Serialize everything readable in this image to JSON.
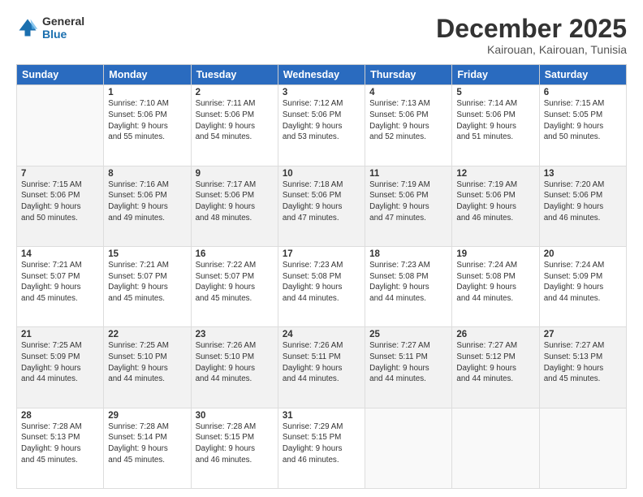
{
  "logo": {
    "line1": "General",
    "line2": "Blue"
  },
  "title": "December 2025",
  "location": "Kairouan, Kairouan, Tunisia",
  "header_days": [
    "Sunday",
    "Monday",
    "Tuesday",
    "Wednesday",
    "Thursday",
    "Friday",
    "Saturday"
  ],
  "weeks": [
    [
      {
        "day": "",
        "info": ""
      },
      {
        "day": "1",
        "info": "Sunrise: 7:10 AM\nSunset: 5:06 PM\nDaylight: 9 hours\nand 55 minutes."
      },
      {
        "day": "2",
        "info": "Sunrise: 7:11 AM\nSunset: 5:06 PM\nDaylight: 9 hours\nand 54 minutes."
      },
      {
        "day": "3",
        "info": "Sunrise: 7:12 AM\nSunset: 5:06 PM\nDaylight: 9 hours\nand 53 minutes."
      },
      {
        "day": "4",
        "info": "Sunrise: 7:13 AM\nSunset: 5:06 PM\nDaylight: 9 hours\nand 52 minutes."
      },
      {
        "day": "5",
        "info": "Sunrise: 7:14 AM\nSunset: 5:06 PM\nDaylight: 9 hours\nand 51 minutes."
      },
      {
        "day": "6",
        "info": "Sunrise: 7:15 AM\nSunset: 5:05 PM\nDaylight: 9 hours\nand 50 minutes."
      }
    ],
    [
      {
        "day": "7",
        "info": "Sunrise: 7:15 AM\nSunset: 5:06 PM\nDaylight: 9 hours\nand 50 minutes."
      },
      {
        "day": "8",
        "info": "Sunrise: 7:16 AM\nSunset: 5:06 PM\nDaylight: 9 hours\nand 49 minutes."
      },
      {
        "day": "9",
        "info": "Sunrise: 7:17 AM\nSunset: 5:06 PM\nDaylight: 9 hours\nand 48 minutes."
      },
      {
        "day": "10",
        "info": "Sunrise: 7:18 AM\nSunset: 5:06 PM\nDaylight: 9 hours\nand 47 minutes."
      },
      {
        "day": "11",
        "info": "Sunrise: 7:19 AM\nSunset: 5:06 PM\nDaylight: 9 hours\nand 47 minutes."
      },
      {
        "day": "12",
        "info": "Sunrise: 7:19 AM\nSunset: 5:06 PM\nDaylight: 9 hours\nand 46 minutes."
      },
      {
        "day": "13",
        "info": "Sunrise: 7:20 AM\nSunset: 5:06 PM\nDaylight: 9 hours\nand 46 minutes."
      }
    ],
    [
      {
        "day": "14",
        "info": "Sunrise: 7:21 AM\nSunset: 5:07 PM\nDaylight: 9 hours\nand 45 minutes."
      },
      {
        "day": "15",
        "info": "Sunrise: 7:21 AM\nSunset: 5:07 PM\nDaylight: 9 hours\nand 45 minutes."
      },
      {
        "day": "16",
        "info": "Sunrise: 7:22 AM\nSunset: 5:07 PM\nDaylight: 9 hours\nand 45 minutes."
      },
      {
        "day": "17",
        "info": "Sunrise: 7:23 AM\nSunset: 5:08 PM\nDaylight: 9 hours\nand 44 minutes."
      },
      {
        "day": "18",
        "info": "Sunrise: 7:23 AM\nSunset: 5:08 PM\nDaylight: 9 hours\nand 44 minutes."
      },
      {
        "day": "19",
        "info": "Sunrise: 7:24 AM\nSunset: 5:08 PM\nDaylight: 9 hours\nand 44 minutes."
      },
      {
        "day": "20",
        "info": "Sunrise: 7:24 AM\nSunset: 5:09 PM\nDaylight: 9 hours\nand 44 minutes."
      }
    ],
    [
      {
        "day": "21",
        "info": "Sunrise: 7:25 AM\nSunset: 5:09 PM\nDaylight: 9 hours\nand 44 minutes."
      },
      {
        "day": "22",
        "info": "Sunrise: 7:25 AM\nSunset: 5:10 PM\nDaylight: 9 hours\nand 44 minutes."
      },
      {
        "day": "23",
        "info": "Sunrise: 7:26 AM\nSunset: 5:10 PM\nDaylight: 9 hours\nand 44 minutes."
      },
      {
        "day": "24",
        "info": "Sunrise: 7:26 AM\nSunset: 5:11 PM\nDaylight: 9 hours\nand 44 minutes."
      },
      {
        "day": "25",
        "info": "Sunrise: 7:27 AM\nSunset: 5:11 PM\nDaylight: 9 hours\nand 44 minutes."
      },
      {
        "day": "26",
        "info": "Sunrise: 7:27 AM\nSunset: 5:12 PM\nDaylight: 9 hours\nand 44 minutes."
      },
      {
        "day": "27",
        "info": "Sunrise: 7:27 AM\nSunset: 5:13 PM\nDaylight: 9 hours\nand 45 minutes."
      }
    ],
    [
      {
        "day": "28",
        "info": "Sunrise: 7:28 AM\nSunset: 5:13 PM\nDaylight: 9 hours\nand 45 minutes."
      },
      {
        "day": "29",
        "info": "Sunrise: 7:28 AM\nSunset: 5:14 PM\nDaylight: 9 hours\nand 45 minutes."
      },
      {
        "day": "30",
        "info": "Sunrise: 7:28 AM\nSunset: 5:15 PM\nDaylight: 9 hours\nand 46 minutes."
      },
      {
        "day": "31",
        "info": "Sunrise: 7:29 AM\nSunset: 5:15 PM\nDaylight: 9 hours\nand 46 minutes."
      },
      {
        "day": "",
        "info": ""
      },
      {
        "day": "",
        "info": ""
      },
      {
        "day": "",
        "info": ""
      }
    ]
  ]
}
